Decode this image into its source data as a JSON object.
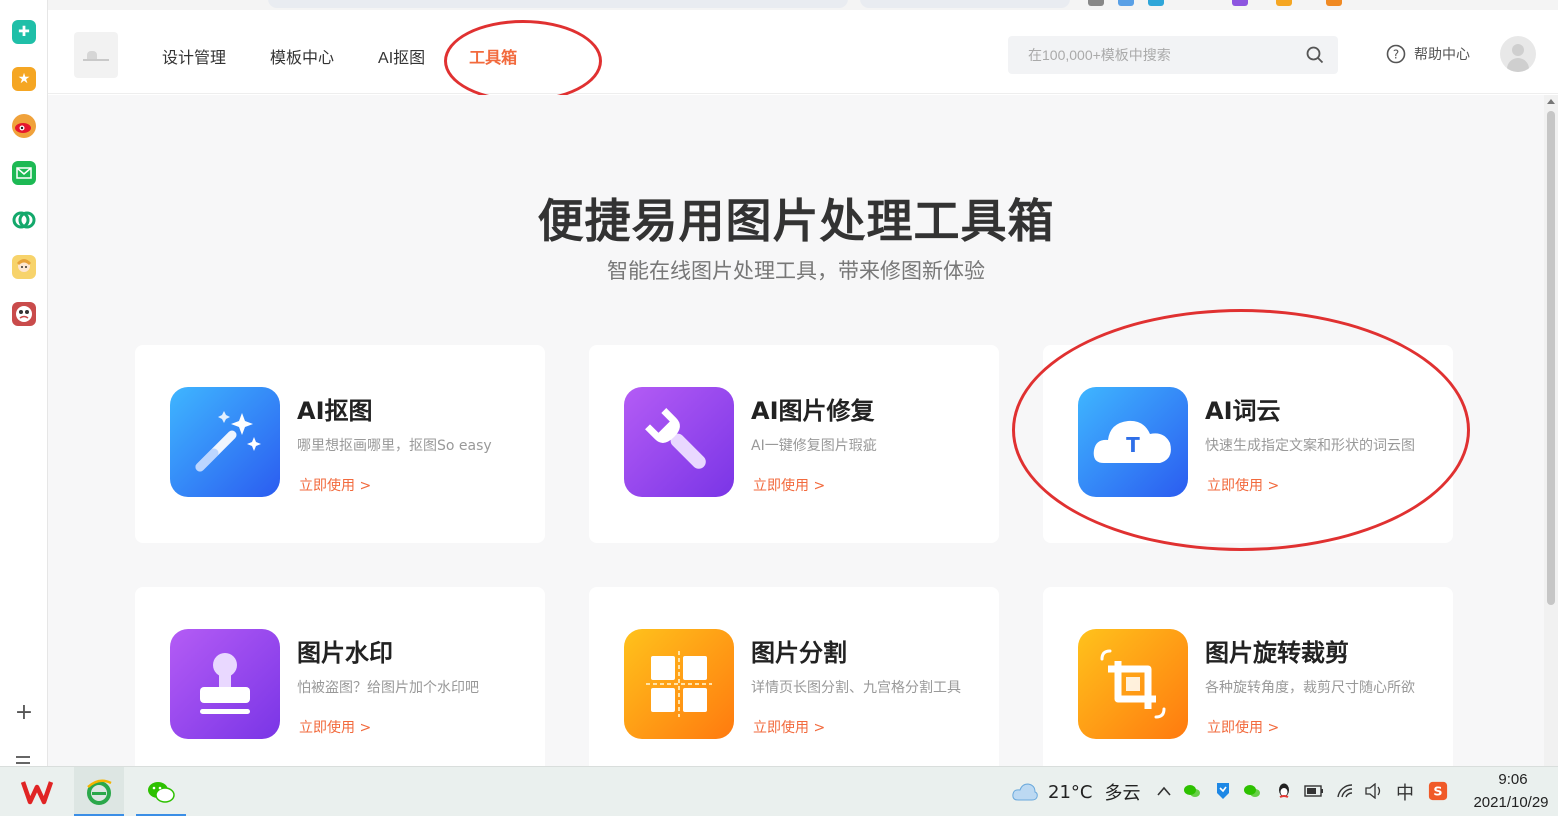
{
  "header": {
    "nav": [
      {
        "label": "设计管理",
        "active": false
      },
      {
        "label": "模板中心",
        "active": false
      },
      {
        "label": "AI抠图",
        "active": false
      },
      {
        "label": "工具箱",
        "active": true
      }
    ],
    "search_placeholder": "在100,000+模板中搜索",
    "help_label": "帮助中心"
  },
  "hero": {
    "title": "便捷易用图片处理工具箱",
    "subtitle": "智能在线图片处理工具，带来修图新体验"
  },
  "tools": [
    {
      "title": "AI抠图",
      "desc": "哪里想抠画哪里，抠图So easy",
      "action": "立即使用 >",
      "icon": "magic-wand-icon"
    },
    {
      "title": "AI图片修复",
      "desc": "AI一键修复图片瑕疵",
      "action": "立即使用 >",
      "icon": "wrench-icon"
    },
    {
      "title": "AI词云",
      "desc": "快速生成指定文案和形状的词云图",
      "action": "立即使用 >",
      "icon": "word-cloud-icon"
    },
    {
      "title": "图片水印",
      "desc": "怕被盗图？给图片加个水印吧",
      "action": "立即使用 >",
      "icon": "stamp-icon"
    },
    {
      "title": "图片分割",
      "desc": "详情页长图分割、九宫格分割工具",
      "action": "立即使用 >",
      "icon": "grid-split-icon"
    },
    {
      "title": "图片旋转裁剪",
      "desc": "各种旋转角度，裁剪尺寸随心所欲",
      "action": "立即使用 >",
      "icon": "crop-rotate-icon"
    }
  ],
  "colors": {
    "accent": "#f26a3d",
    "annotation": "#e03131",
    "page_bg": "#f7f7f8"
  },
  "side_panel": {
    "icons": [
      "plus-cross-icon",
      "star-icon",
      "weibo-icon",
      "mail-icon",
      "sync-icon",
      "avatar-app-icon",
      "game-icon"
    ]
  },
  "taskbar": {
    "apps": [
      "wps-icon",
      "ie-icon",
      "wechat-icon"
    ],
    "weather": {
      "temp": "21°C",
      "condition": "多云"
    },
    "ime": "中",
    "time": "9:06",
    "date": "2021/10/29"
  }
}
